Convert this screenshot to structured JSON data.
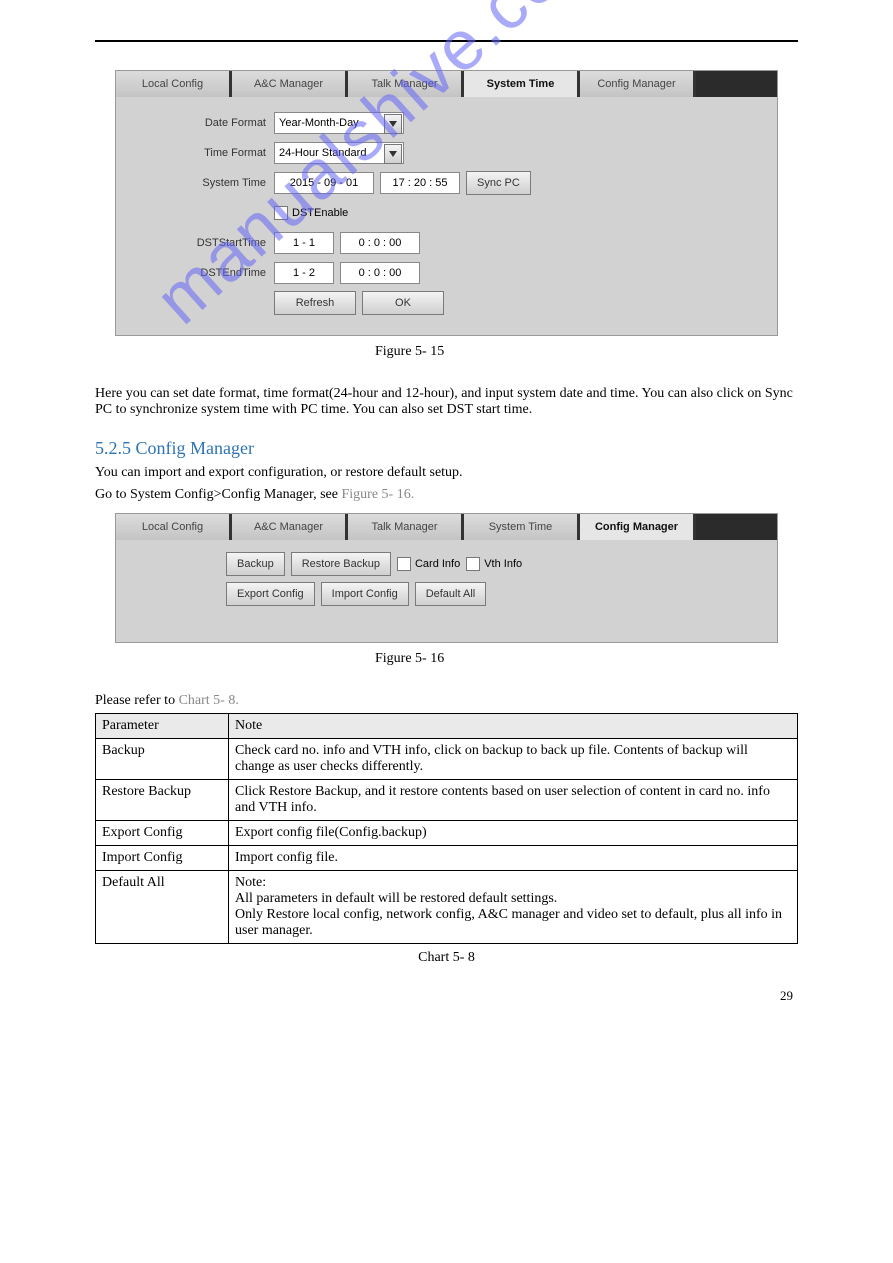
{
  "figure1": {
    "tabs": [
      "Local Config",
      "A&C Manager",
      "Talk Manager",
      "System Time",
      "Config Manager"
    ],
    "activeTab": "System Time",
    "form": {
      "dateFormat_label": "Date Format",
      "dateFormat_value": "Year-Month-Day",
      "timeFormat_label": "Time Format",
      "timeFormat_value": "24-Hour Standard",
      "systemTime_label": "System Time",
      "systemTime_date": "2015 - 09 - 01",
      "systemTime_time": "17 : 20 : 55",
      "syncPcBtn": "Sync PC",
      "dstEnable_label": "DSTEnable",
      "dstStart_label": "DSTStartTime",
      "dstStart_date": "1 - 1",
      "dstStart_time": "0 : 0 : 00",
      "dstEnd_label": "DSTEndTime",
      "dstEnd_date": "1 - 2",
      "dstEnd_time": "0 : 0 : 00",
      "refreshBtn": "Refresh",
      "okBtn": "OK"
    },
    "caption": "Figure 5- 15"
  },
  "paragraph1": "Here you can set date format, time format(24-hour and 12-hour), and input system date and time. You can also click on Sync PC to synchronize system time with PC time. You can also set DST start time.",
  "section": {
    "title": "5.2.5 Config Manager",
    "intro1": "You can import and export configuration, or restore default setup.",
    "intro2": "Go to System Config>Config Manager, see"
  },
  "figure2": {
    "tabs": [
      "Local Config",
      "A&C Manager",
      "Talk Manager",
      "System Time",
      "Config Manager"
    ],
    "activeTab": "Config Manager",
    "buttons": {
      "backup": "Backup",
      "restore": "Restore Backup",
      "cardInfo": "Card Info",
      "vthInfo": "Vth Info",
      "exportConfig": "Export Config",
      "importConfig": "Import Config",
      "defaultAll": "Default All"
    },
    "caption": "Figure 5- 16"
  },
  "tableCaption": "Chart 5- 8",
  "table": {
    "headerParam": "Parameter",
    "headerNote": "Note",
    "rows": [
      {
        "p": "Backup",
        "n": "Check card no. info and VTH info, click on backup to back up file. Contents of backup will change as user checks differently."
      },
      {
        "p": "Restore Backup",
        "n": "Click Restore Backup, and it restore contents based on user selection of content in card no. info and VTH info."
      },
      {
        "p": "Export Config",
        "n": "Export config file(Config.backup)"
      },
      {
        "p": "Import Config",
        "n": "Import config file."
      },
      {
        "p": "Default All",
        "n": "Note:\nAll parameters in default will be restored default settings.\nOnly Restore local config, network config, A&C manager and video set to default, plus all info in user manager."
      }
    ]
  },
  "figure2_linkref": "Figure 5- 16.",
  "tableCaptionLinkref": "Chart 5- 8.",
  "footer": {
    "left": "",
    "right": "29"
  }
}
